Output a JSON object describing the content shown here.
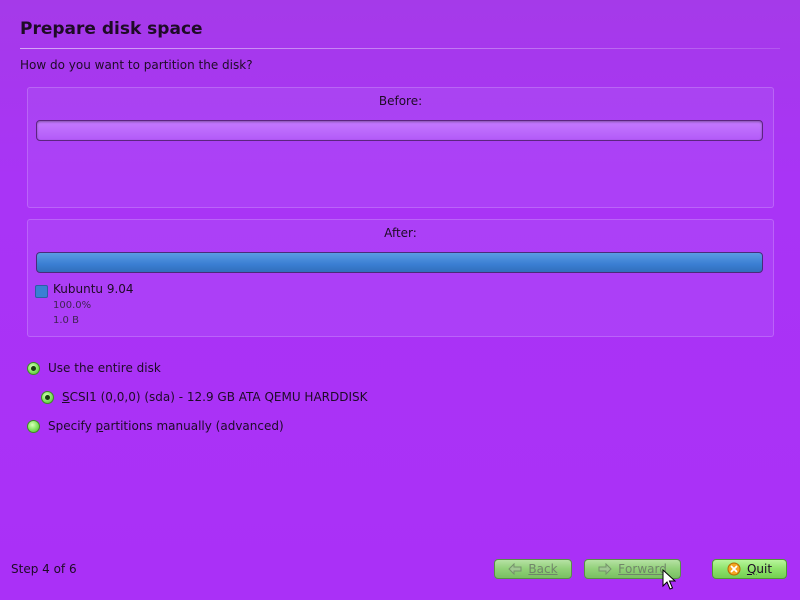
{
  "header": {
    "title": "Prepare disk space",
    "question": "How do you want to partition the disk?"
  },
  "before_panel": {
    "label": "Before:"
  },
  "after_panel": {
    "label": "After:",
    "partition": {
      "name": "Kubuntu 9.04",
      "percent": "100.0%",
      "size": "1.0 B",
      "color": "#3a7fd4"
    }
  },
  "options": {
    "entire_disk": {
      "label_underlined": "",
      "label_rest": "Use the entire disk",
      "checked": true
    },
    "disk": {
      "label_underlined": "S",
      "label_rest": "CSI1 (0,0,0) (sda) - 12.9 GB ATA QEMU HARDDISK",
      "checked": true
    },
    "manual": {
      "label_pre": "Specify ",
      "label_underlined": "p",
      "label_rest": "artitions manually (advanced)",
      "checked": false
    }
  },
  "footer": {
    "step": "Step 4 of 6",
    "back": {
      "underlined": "B",
      "rest": "ack",
      "icon": "back-arrow-icon"
    },
    "forward": {
      "underlined": "F",
      "rest": "orward",
      "icon": "forward-arrow-icon"
    },
    "quit": {
      "underlined": "Q",
      "rest": "uit",
      "icon": "quit-icon"
    }
  },
  "colors": {
    "background": "#aa30f7",
    "button_green": "#8ee26b",
    "partition_blue": "#3a7fd4"
  }
}
